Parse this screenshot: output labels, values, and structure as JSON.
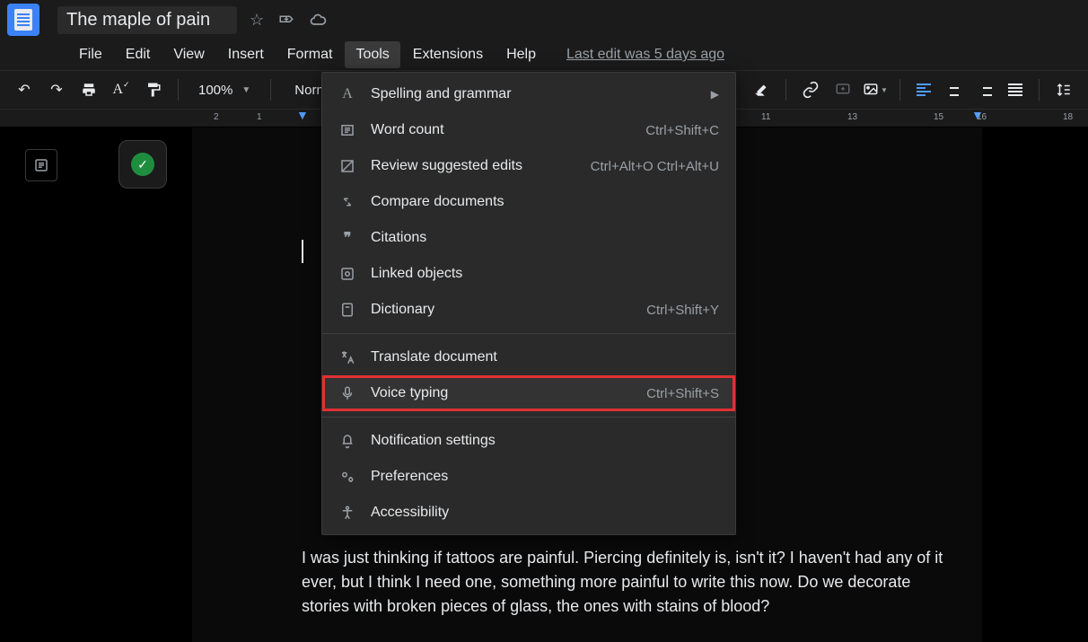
{
  "doc": {
    "title": "The maple of pain",
    "last_edit": "Last edit was 5 days ago",
    "body_text": "I was just thinking if tattoos are painful. Piercing definitely is, isn't it? I haven't had any of it ever, but I think I need one, something more painful to write this now. Do we decorate stories with broken pieces of glass, the ones with stains of blood?"
  },
  "menus": {
    "file": "File",
    "edit": "Edit",
    "view": "View",
    "insert": "Insert",
    "format": "Format",
    "tools": "Tools",
    "extensions": "Extensions",
    "help": "Help"
  },
  "toolbar": {
    "zoom": "100%",
    "style": "Normal"
  },
  "ruler": {
    "n2": "2",
    "n1": "1",
    "n11": "11",
    "n13": "13",
    "n15": "15",
    "n16": "16",
    "n18": "18"
  },
  "tools_menu": {
    "spelling": "Spelling and grammar",
    "word_count": {
      "label": "Word count",
      "shortcut": "Ctrl+Shift+C"
    },
    "review": {
      "label": "Review suggested edits",
      "shortcut": "Ctrl+Alt+O Ctrl+Alt+U"
    },
    "compare": "Compare documents",
    "citations": "Citations",
    "linked": "Linked objects",
    "dictionary": {
      "label": "Dictionary",
      "shortcut": "Ctrl+Shift+Y"
    },
    "translate": "Translate document",
    "voice": {
      "label": "Voice typing",
      "shortcut": "Ctrl+Shift+S"
    },
    "notifications": "Notification settings",
    "preferences": "Preferences",
    "accessibility": "Accessibility"
  }
}
